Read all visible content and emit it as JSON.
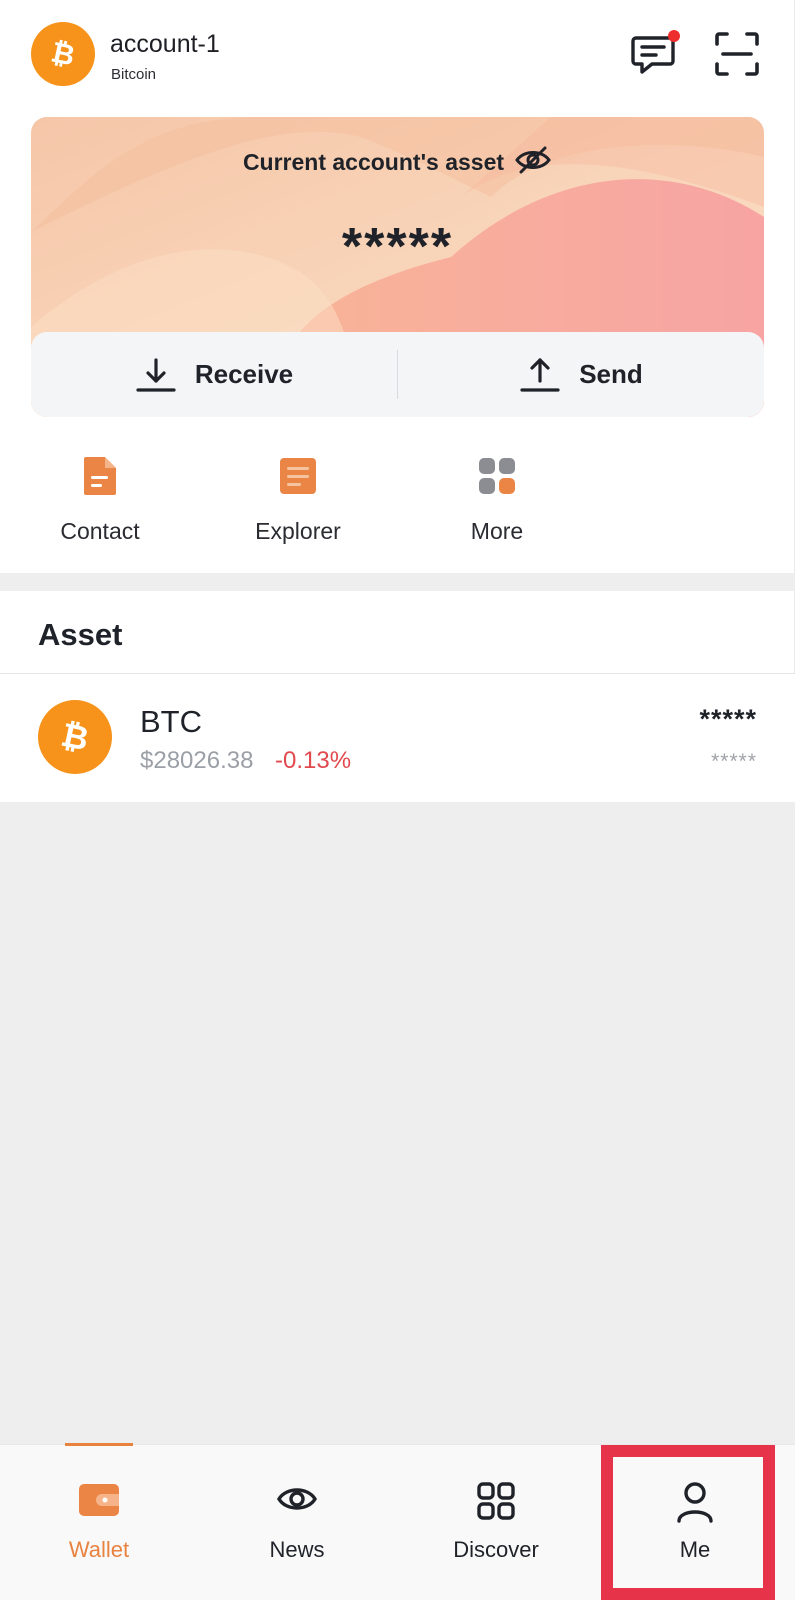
{
  "header": {
    "account_name": "account-1",
    "chain_name": "Bitcoin",
    "icons": [
      "bitcoin-logo-icon",
      "message-icon",
      "scan-icon"
    ]
  },
  "asset_card": {
    "title": "Current account's asset",
    "masked_total": "*****",
    "receive_label": "Receive",
    "send_label": "Send",
    "gradient_colors": [
      "#fbe0c7",
      "#f8c6a4",
      "#f8a89d",
      "#fbd6c4"
    ]
  },
  "quick_links": [
    {
      "label": "Contact",
      "icon": "contact-document-icon"
    },
    {
      "label": "Explorer",
      "icon": "explorer-icon"
    },
    {
      "label": "More",
      "icon": "more-grid-icon"
    }
  ],
  "assets": {
    "heading": "Asset",
    "rows": [
      {
        "symbol": "BTC",
        "price": "$28026.38",
        "change": "-0.13%",
        "balance": "*****",
        "value": "*****"
      }
    ]
  },
  "bottom_nav": {
    "items": [
      {
        "label": "Wallet",
        "icon": "wallet-icon",
        "active": true
      },
      {
        "label": "News",
        "icon": "eye-icon",
        "active": false
      },
      {
        "label": "Discover",
        "icon": "grid-icon",
        "active": false
      },
      {
        "label": "Me",
        "icon": "person-icon",
        "active": false
      }
    ]
  },
  "colors": {
    "accent": "#e8823f",
    "bitcoin": "#f7931a",
    "negative": "#e0494d",
    "highlight": "#e6334a"
  }
}
